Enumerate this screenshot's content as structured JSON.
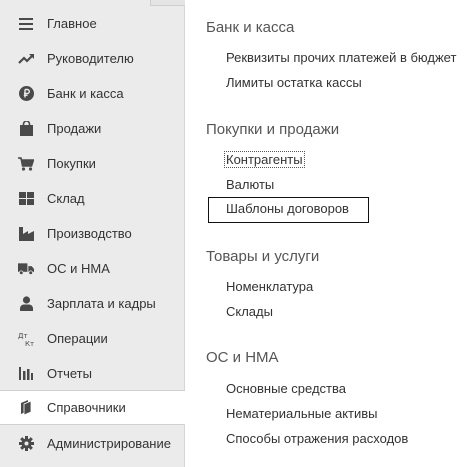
{
  "sidebar": {
    "items": [
      {
        "label": "Главное",
        "icon": "menu-lines-icon"
      },
      {
        "label": "Руководителю",
        "icon": "trend-chart-icon"
      },
      {
        "label": "Банк и касса",
        "icon": "ruble-coin-icon"
      },
      {
        "label": "Продажи",
        "icon": "shopping-bag-icon"
      },
      {
        "label": "Покупки",
        "icon": "shopping-cart-icon"
      },
      {
        "label": "Склад",
        "icon": "warehouse-grid-icon"
      },
      {
        "label": "Производство",
        "icon": "factory-icon"
      },
      {
        "label": "ОС и НМА",
        "icon": "truck-icon"
      },
      {
        "label": "Зарплата и кадры",
        "icon": "person-icon"
      },
      {
        "label": "Операции",
        "icon": "debit-credit-icon"
      },
      {
        "label": "Отчеты",
        "icon": "bar-chart-icon"
      },
      {
        "label": "Справочники",
        "icon": "book-icon"
      },
      {
        "label": "Администрирование",
        "icon": "gear-icon"
      }
    ],
    "active_index": 11
  },
  "sections": [
    {
      "title": "Банк и касса",
      "links": [
        "Реквизиты прочих платежей в бюджет",
        "Лимиты остатка кассы"
      ]
    },
    {
      "title": "Покупки и продажи",
      "links": [
        "Контрагенты",
        "Валюты",
        "Шаблоны договоров"
      ]
    },
    {
      "title": "Товары и услуги",
      "links": [
        "Номенклатура",
        "Склады"
      ]
    },
    {
      "title": "ОС и НМА",
      "links": [
        "Основные средства",
        "Нематериальные активы",
        "Способы отражения расходов"
      ]
    }
  ],
  "colors": {
    "sidebar_bg": "#ebebeb",
    "icon": "#4a4a4a",
    "text": "#333333",
    "section_title": "#555555",
    "selection_border": "#111111"
  }
}
